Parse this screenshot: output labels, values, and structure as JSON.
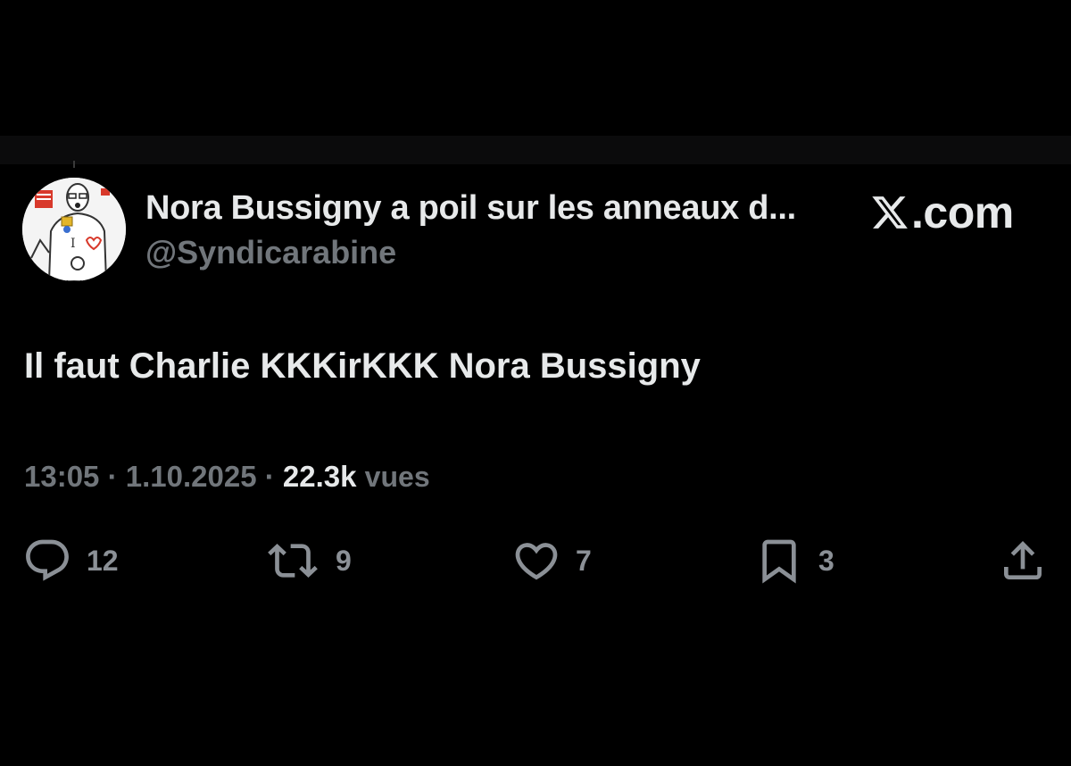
{
  "author": {
    "display_name": "Nora Bussigny a poil sur les anneaux d...",
    "handle": "@Syndicarabine"
  },
  "brand": {
    "text": ".com",
    "icon": "x-logo-icon"
  },
  "tweet": {
    "text": "Il faut Charlie KKKirKKK Nora Bussigny"
  },
  "meta": {
    "time": "13:05",
    "separator": "·",
    "date": "1.10.2025",
    "views_count": "22.3k",
    "views_label": "vues"
  },
  "actions": {
    "reply": {
      "icon": "reply-icon",
      "count": "12"
    },
    "repost": {
      "icon": "repost-icon",
      "count": "9"
    },
    "like": {
      "icon": "heart-icon",
      "count": "7"
    },
    "bookmark": {
      "icon": "bookmark-icon",
      "count": "3"
    },
    "share": {
      "icon": "share-icon"
    }
  },
  "colors": {
    "background": "#000000",
    "primary_text": "#e7e9ea",
    "secondary_text": "#71767b",
    "icon": "#8b9096"
  }
}
